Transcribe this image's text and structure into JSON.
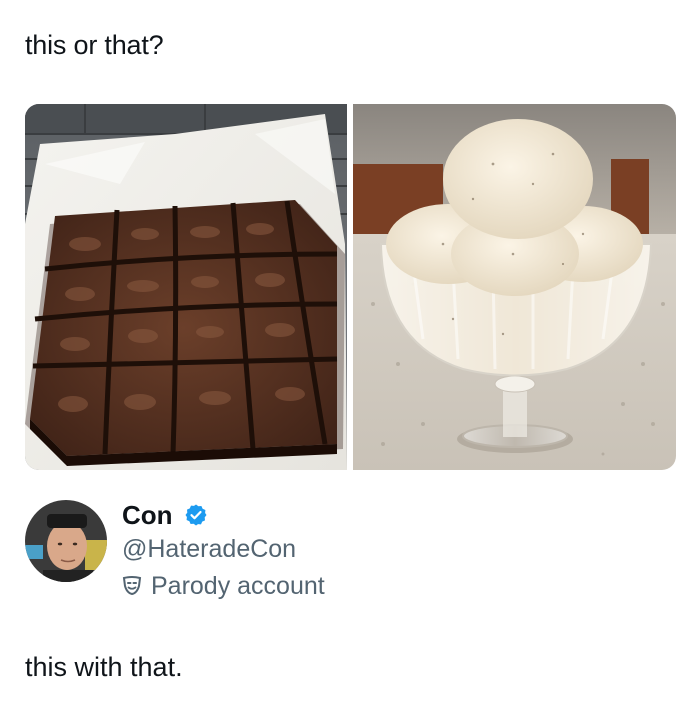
{
  "prompt": {
    "text": "this or that?"
  },
  "media": {
    "left_image": {
      "alt": "brownies"
    },
    "right_image": {
      "alt": "vanilla ice cream in glass dish"
    }
  },
  "reply": {
    "author": {
      "display_name": "Con",
      "handle": "@HateradeCon",
      "label": "Parody account",
      "verified": true
    },
    "text": "this with that."
  },
  "colors": {
    "text_primary": "#0f1419",
    "text_secondary": "#536471",
    "verified_blue": "#1d9bf0"
  },
  "icons": [
    "verified-badge-icon",
    "parody-mask-icon"
  ]
}
